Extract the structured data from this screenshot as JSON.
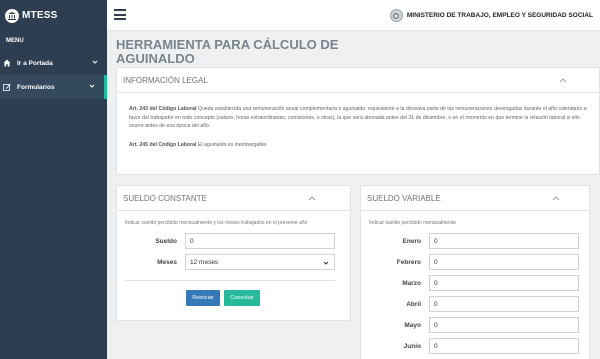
{
  "app": {
    "brand": "MTESS"
  },
  "sidebar": {
    "menu_label": "MENU",
    "items": [
      {
        "label": "Ir a Portada",
        "icon": "home-icon"
      },
      {
        "label": "Formularios",
        "icon": "edit-icon"
      }
    ]
  },
  "topbar": {
    "ministry": "MINISTERIO DE TRABAJO, EMPLEO Y SEGURIDAD SOCIAL"
  },
  "page": {
    "title": "HERRAMIENTA PARA CÁLCULO DE AGUINALDO"
  },
  "legal": {
    "header": "INFORMACIÓN LEGAL",
    "art243_label": "Art. 243 del Código Laboral",
    "art243_text": "Queda establecida una remuneración anual complementaria o aguinaldo, equivalente a la doceava parte de las remuneraciones devengadas durante el año calendario a favor del trabajador en todo concepto (salario, horas extraordinarias, comisiones, u otras), la que será abonada antes del 31 de diciembre, o en el momento en que termine la relación laboral si ello ocurre antes de esa época del año.",
    "art245_label": "Art. 245 del Código Laboral",
    "art245_text": "El aguinaldo es inembargable."
  },
  "sueldo_constante": {
    "header": "SUELDO CONSTANTE",
    "hint": "Indicar sueldo percibido mensualmente y los meses trabajados en el presente año",
    "sueldo_label": "Sueldo",
    "sueldo_value": "0",
    "meses_label": "Meses",
    "meses_value": "12 meses",
    "reset_label": "Reiniciar",
    "query_label": "Consultar"
  },
  "sueldo_variable": {
    "header": "SUELDO VARIABLE",
    "hint": "Indicar sueldo percibido mensualmente",
    "months": [
      {
        "label": "Enero",
        "value": "0"
      },
      {
        "label": "Febrero",
        "value": "0"
      },
      {
        "label": "Marzo",
        "value": "0"
      },
      {
        "label": "Abril",
        "value": "0"
      },
      {
        "label": "Mayo",
        "value": "0"
      },
      {
        "label": "Junio",
        "value": "0"
      }
    ]
  },
  "colors": {
    "sidebar": "#2c3e50",
    "primary": "#337ab7",
    "success": "#26b99a",
    "accent": "#1abc9c"
  }
}
